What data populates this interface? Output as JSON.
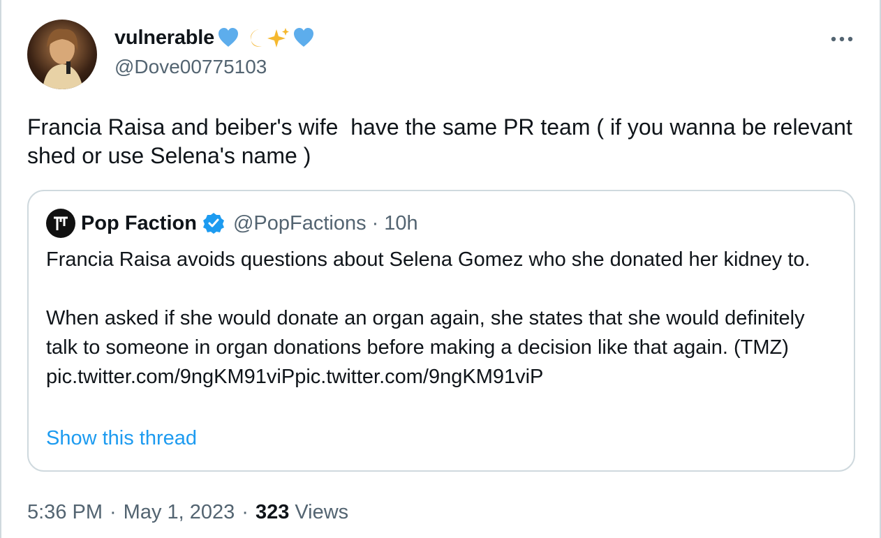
{
  "author": {
    "display_name": "vulnerable",
    "handle": "@Dove00775103",
    "emoji_names": [
      "blue-heart-icon",
      "crescent-moon-icon",
      "sparkles-icon",
      "blue-heart-icon"
    ]
  },
  "tweet": {
    "text": "Francia Raisa and beiber's wife  have the same PR team ( if you wanna be relevant shed or use Selena's name )",
    "time": "5:36 PM",
    "date": "May 1, 2023",
    "separator": "·",
    "views_count": "323",
    "views_label": "Views"
  },
  "quoted": {
    "name": "Pop Faction",
    "handle": "@PopFactions",
    "separator": "·",
    "time": "10h",
    "text": "Francia Raisa avoids questions about Selena Gomez who she donated her kidney to.\n\nWhen asked if she would donate an organ again, she states that she would definitely talk to someone in organ donations before making a decision like that again. (TMZ) pic.twitter.com/9ngKM91viPpic.twitter.com/9ngKM91viP",
    "show_thread": "Show this thread"
  },
  "colors": {
    "text_primary": "#0f1419",
    "text_secondary": "#536471",
    "accent_blue": "#1d9bf0",
    "border": "#cfd9de"
  }
}
